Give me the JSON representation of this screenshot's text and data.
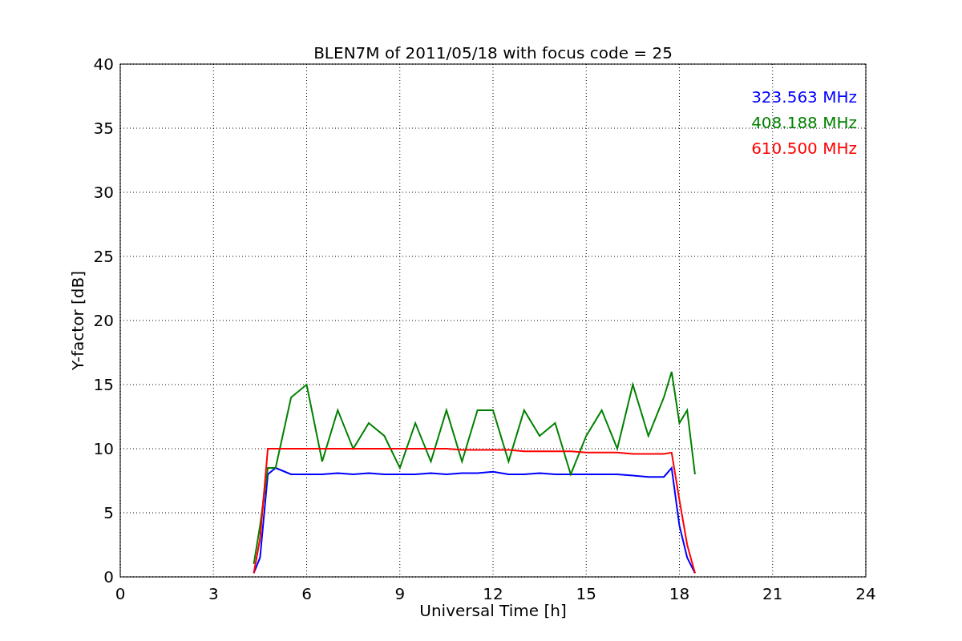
{
  "figure": {
    "chart_data": {
      "type": "line",
      "title": "BLEN7M of 2011/05/18 with focus code = 25",
      "xlabel": "Universal Time [h]",
      "ylabel": "Y-factor [dB]",
      "x": [
        4.3,
        4.5,
        4.75,
        5,
        5.5,
        6,
        6.5,
        7,
        7.5,
        8,
        8.5,
        9,
        9.5,
        10,
        10.5,
        11,
        11.5,
        12,
        12.5,
        13,
        13.5,
        14,
        14.5,
        15,
        15.5,
        16,
        16.5,
        17,
        17.5,
        17.75,
        18,
        18.25,
        18.5
      ],
      "series": [
        {
          "name": "323.563 MHz",
          "color": "#0000ff",
          "values": [
            0.3,
            1.5,
            8,
            8.5,
            8,
            8,
            8,
            8.1,
            8,
            8.1,
            8,
            8,
            8,
            8.1,
            8,
            8.1,
            8.1,
            8.2,
            8,
            8,
            8.1,
            8,
            8,
            8,
            8,
            8,
            7.9,
            7.8,
            7.8,
            8.5,
            4,
            1.5,
            0.3
          ]
        },
        {
          "name": "408.188 MHz",
          "color": "#008000",
          "values": [
            1,
            4,
            8.5,
            8.5,
            14,
            15,
            9,
            13,
            10,
            12,
            11,
            8.5,
            12,
            9,
            13,
            9,
            13,
            13,
            9,
            13,
            11,
            12,
            8,
            11,
            13,
            10,
            15,
            11,
            14,
            16,
            12,
            13,
            8
          ]
        },
        {
          "name": "610.500 MHz",
          "color": "#ff0000",
          "values": [
            0.3,
            3,
            10,
            10,
            10,
            10,
            10,
            10,
            10,
            10,
            10,
            10,
            10,
            10,
            10,
            9.9,
            9.9,
            9.9,
            9.9,
            9.8,
            9.8,
            9.8,
            9.8,
            9.7,
            9.7,
            9.7,
            9.6,
            9.6,
            9.6,
            9.7,
            6,
            2.5,
            0.3
          ]
        }
      ],
      "grid": true,
      "xlim": [
        0,
        24
      ],
      "ylim": [
        0,
        40
      ],
      "xticks": [
        0,
        3,
        6,
        9,
        12,
        15,
        18,
        21,
        24
      ],
      "yticks": [
        0,
        5,
        10,
        15,
        20,
        25,
        30,
        35,
        40
      ]
    }
  }
}
